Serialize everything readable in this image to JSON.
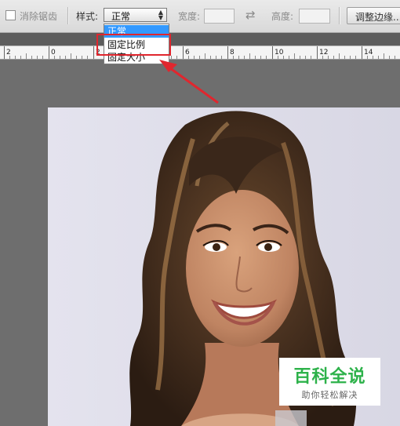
{
  "options_bar": {
    "antialias_label": "消除锯齿",
    "style_label": "样式:",
    "style_value": "正常",
    "width_label": "宽度:",
    "height_label": "高度:",
    "refine_edge_label": "调整边缘..."
  },
  "style_dropdown": {
    "options": [
      "正常",
      "固定比例",
      "固定大小"
    ],
    "selected_index": 0,
    "highlighted_option": "固定比例"
  },
  "ruler": {
    "labels": [
      "2",
      "0",
      "2",
      "4",
      "6",
      "8",
      "10",
      "12",
      "14"
    ]
  },
  "watermark": {
    "title": "百科全说",
    "subtitle": "助你轻松解决"
  },
  "annotation_color": "#e0262e",
  "accent_color": "#3399ff",
  "icons": [
    "checkbox-icon",
    "chevron-updown-icon",
    "swap-icon",
    "arrow-annotation-icon"
  ]
}
